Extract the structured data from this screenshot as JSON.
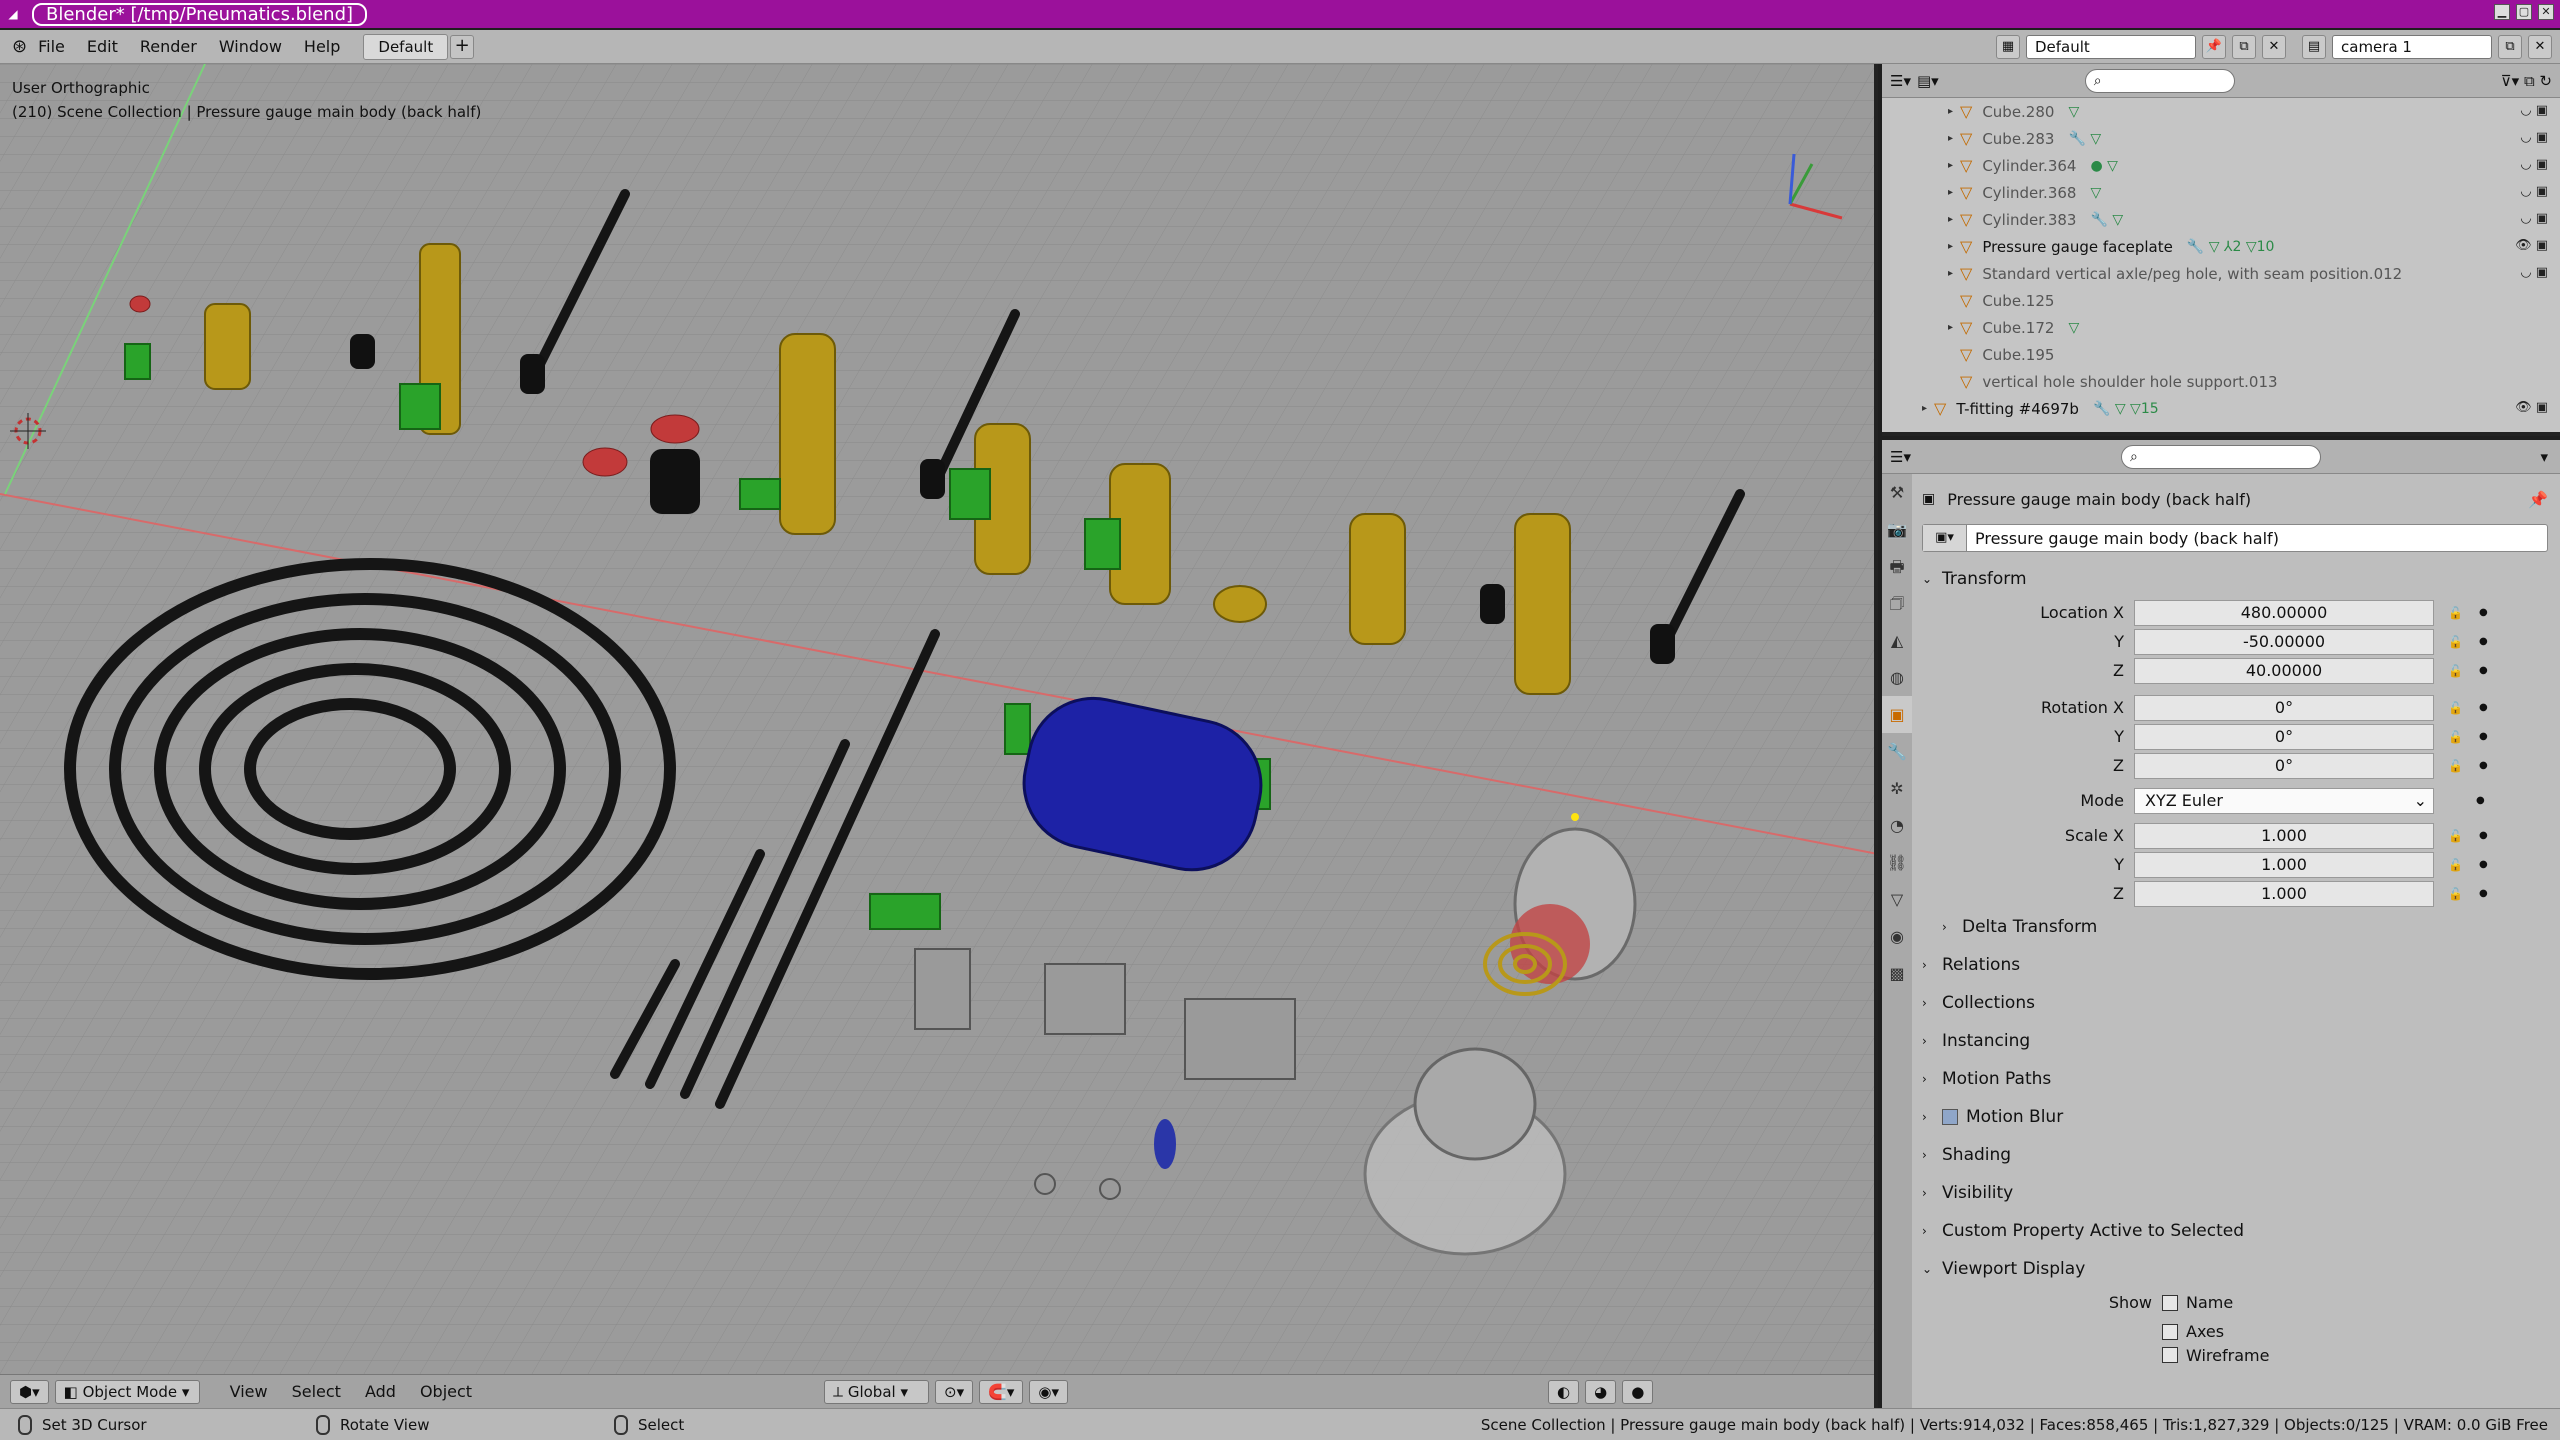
{
  "window": {
    "title": "Blender* [/tmp/Pneumatics.blend]"
  },
  "menubar": {
    "items": [
      "File",
      "Edit",
      "Render",
      "Window",
      "Help"
    ],
    "workspace": "Default",
    "layout": "Default",
    "scene": "camera 1"
  },
  "viewport": {
    "view_name": "User Orthographic",
    "context": "(210) Scene Collection | Pressure gauge main body (back half)",
    "header": {
      "mode": "Object Mode",
      "menus": [
        "View",
        "Select",
        "Add",
        "Object"
      ],
      "orientation": "Global"
    }
  },
  "outliner": {
    "rows": [
      {
        "name": "Cube.280",
        "extra": "▽",
        "expand": "▸"
      },
      {
        "name": "Cube.283",
        "extra": "🔧 ▽",
        "expand": "▸"
      },
      {
        "name": "Cylinder.364",
        "extra": "● ▽",
        "expand": "▸"
      },
      {
        "name": "Cylinder.368",
        "extra": "▽",
        "expand": "▸"
      },
      {
        "name": "Cylinder.383",
        "extra": "🔧 ▽",
        "expand": "▸"
      },
      {
        "name": "Pressure gauge faceplate",
        "extra": "🔧 ▽ ⅄2 ▽10",
        "expand": "▸",
        "active": true
      },
      {
        "name": "Standard vertical axle/peg hole, with seam position.012",
        "extra": "",
        "expand": "▸"
      },
      {
        "name": "Cube.125",
        "extra": "",
        "expand": ""
      },
      {
        "name": "Cube.172",
        "extra": "▽",
        "expand": "▸"
      },
      {
        "name": "Cube.195",
        "extra": "",
        "expand": ""
      },
      {
        "name": "vertical hole shoulder hole support.013",
        "extra": "",
        "expand": ""
      },
      {
        "name": "T-fitting #4697b",
        "extra": "🔧 ▽ ▽15",
        "expand": "▸",
        "active": true
      }
    ]
  },
  "properties": {
    "object_header": "Pressure gauge main body (back half)",
    "object_name": "Pressure gauge main body (back half)",
    "transform": {
      "title": "Transform",
      "location_label": "Location X",
      "loc_x": "480.00000",
      "loc_y": "-50.00000",
      "loc_z": "40.00000",
      "rotation_label": "Rotation X",
      "rot_x": "0°",
      "rot_y": "0°",
      "rot_z": "0°",
      "mode_label": "Mode",
      "mode": "XYZ Euler",
      "scale_label": "Scale X",
      "scale_x": "1.000",
      "scale_y": "1.000",
      "scale_z": "1.000",
      "y": "Y",
      "z": "Z"
    },
    "delta": "Delta Transform",
    "panels": [
      "Relations",
      "Collections",
      "Instancing",
      "Motion Paths",
      "Motion Blur",
      "Shading",
      "Visibility",
      "Custom Property Active to Selected",
      "Viewport Display"
    ],
    "viewport_display": {
      "show_label": "Show",
      "name": "Name",
      "axes": "Axes",
      "wire": "Wireframe"
    }
  },
  "statusbar": {
    "hints": [
      "Set 3D Cursor",
      "Rotate View",
      "Select"
    ],
    "stats": "Scene Collection | Pressure gauge main body (back half) | Verts:914,032 | Faces:858,465 | Tris:1,827,329 | Objects:0/125 | VRAM: 0.0 GiB Free"
  }
}
